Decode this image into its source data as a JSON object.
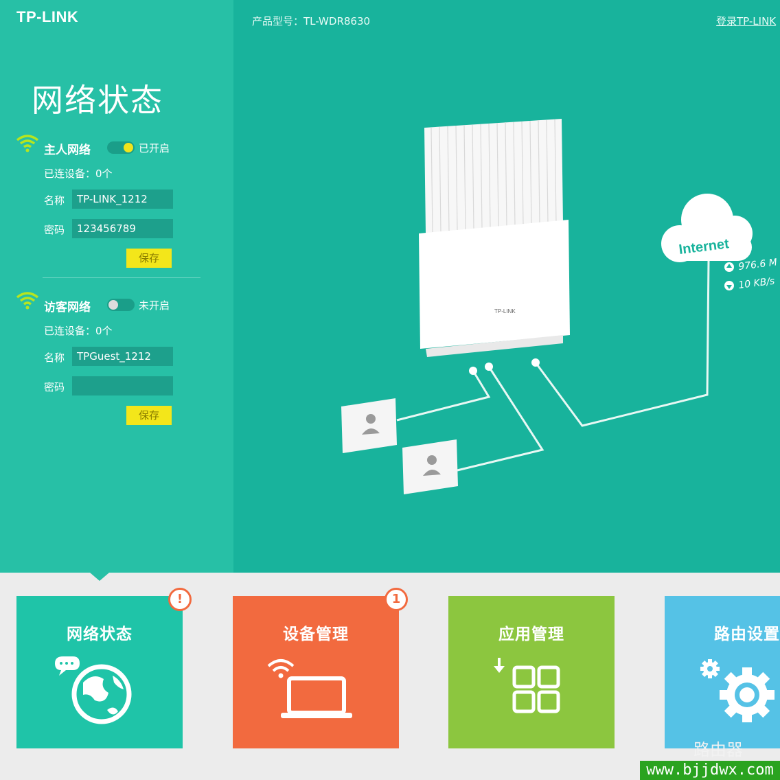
{
  "header": {
    "logo": "TP-LINK",
    "model_label": "产品型号：TL-WDR8630",
    "login_link": "登录TP-LINK"
  },
  "sidebar": {
    "title": "网络状态",
    "main_network": {
      "name": "主人网络",
      "state": "已开启",
      "enabled": true,
      "connected": "已连设备：0个",
      "ssid_label": "名称",
      "ssid": "TP-LINK_1212",
      "password_label": "密码",
      "password": "123456789",
      "save": "保存"
    },
    "guest_network": {
      "name": "访客网络",
      "state": "未开启",
      "enabled": false,
      "connected": "已连设备：0个",
      "ssid_label": "名称",
      "ssid": "TPGuest_1212",
      "password_label": "密码",
      "password": "",
      "save": "保存"
    }
  },
  "diagram": {
    "cloud_label": "Internet",
    "upload": "976.6 M",
    "download": "10 KB/s",
    "router_brand": "TP-LINK"
  },
  "tiles": [
    {
      "label": "网络状态",
      "color": "#1fc4a8",
      "badge": "!",
      "icon": "globe-icon"
    },
    {
      "label": "设备管理",
      "color": "#f26a3f",
      "badge": "1",
      "icon": "laptop-wifi-icon"
    },
    {
      "label": "应用管理",
      "color": "#8cc63f",
      "badge": "",
      "icon": "apps-grid-icon"
    },
    {
      "label": "路由设置",
      "color": "#55c2e6",
      "badge": "",
      "icon": "gear-icon"
    }
  ],
  "watermark": {
    "text": "路由器",
    "site": "www.bjjdwx.com"
  },
  "colors": {
    "main_bg": "#18b39c",
    "panel_bg": "#27c0a6",
    "save_button": "#f3e61a",
    "toggle_on_knob": "#f0e41c"
  }
}
